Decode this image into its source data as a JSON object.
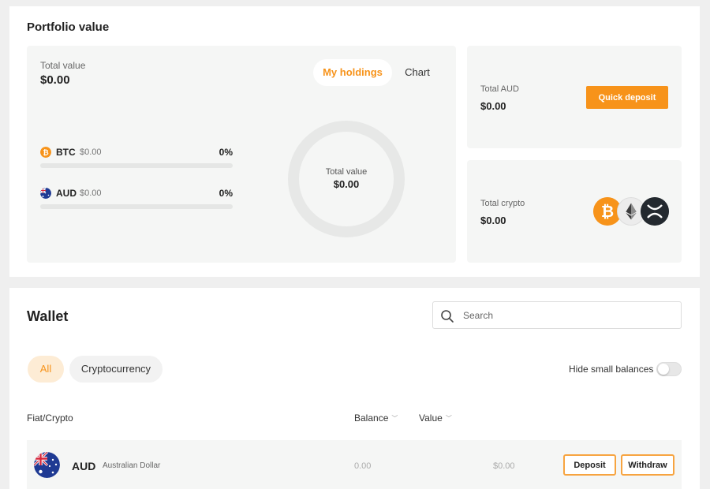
{
  "portfolio": {
    "title": "Portfolio value",
    "total_label": "Total value",
    "total_value": "$0.00",
    "tabs": {
      "holdings": "My holdings",
      "chart": "Chart",
      "active": "My holdings"
    },
    "assets": [
      {
        "code": "BTC",
        "amount": "$0.00",
        "percent": "0%",
        "icon": "bitcoin-icon",
        "percent_value": 0
      },
      {
        "code": "AUD",
        "amount": "$0.00",
        "percent": "0%",
        "icon": "australia-flag-icon",
        "percent_value": 0
      }
    ],
    "donut": {
      "label": "Total value",
      "value": "$0.00"
    },
    "aud_panel": {
      "label": "Total AUD",
      "value": "$0.00",
      "button": "Quick deposit"
    },
    "crypto_panel": {
      "label": "Total crypto",
      "value": "$0.00",
      "coins": [
        "bitcoin-icon",
        "ethereum-icon",
        "xrp-icon"
      ]
    }
  },
  "wallet": {
    "title": "Wallet",
    "search": {
      "placeholder": "Search",
      "value": ""
    },
    "filters": [
      {
        "label": "All",
        "active": true
      },
      {
        "label": "Cryptocurrency",
        "active": false
      }
    ],
    "hide_small": {
      "label": "Hide small balances",
      "enabled": false
    },
    "columns": {
      "asset": "Fiat/Crypto",
      "balance": "Balance",
      "value": "Value"
    },
    "rows": [
      {
        "code": "AUD",
        "name": "Australian Dollar",
        "balance": "0.00",
        "value": "$0.00",
        "deposit_label": "Deposit",
        "withdraw_label": "Withdraw"
      }
    ]
  },
  "colors": {
    "accent": "#f7931a",
    "panel_bg": "#f5f6f5",
    "page_bg": "#efefef"
  }
}
